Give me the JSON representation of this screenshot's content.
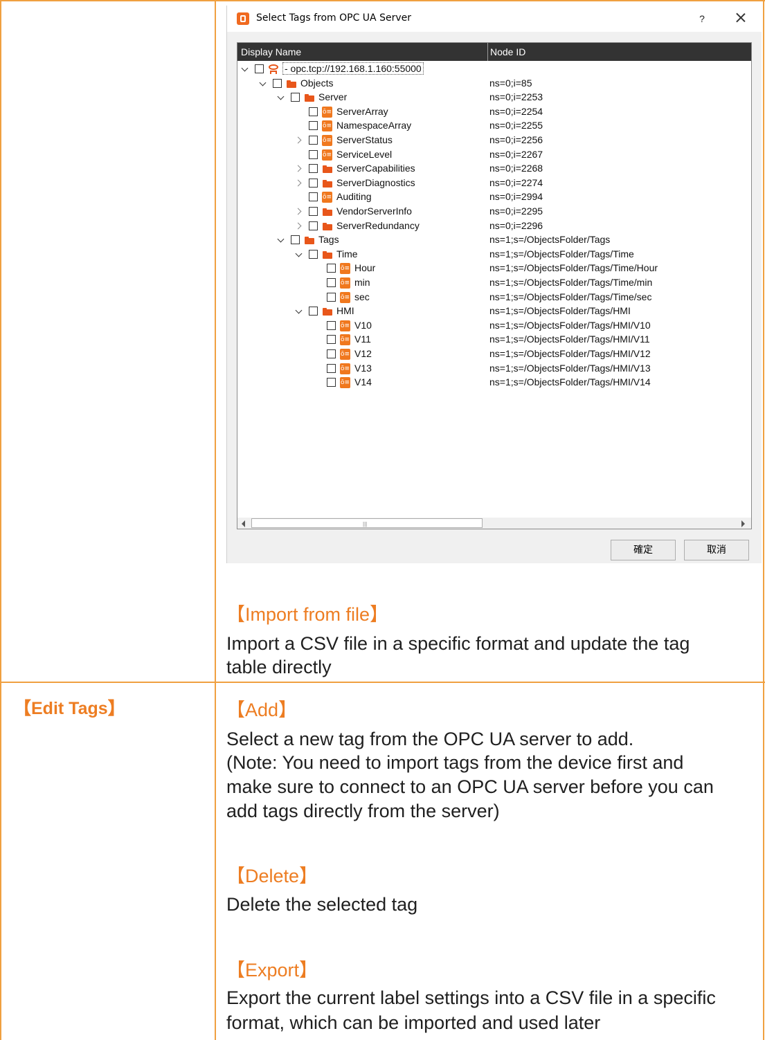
{
  "dialog": {
    "title": "Select Tags from OPC UA Server",
    "help_label": "?",
    "columns": {
      "display_name": "Display Name",
      "node_id": "Node ID"
    },
    "tree": [
      {
        "level": 0,
        "expander": "down",
        "icon": "server",
        "label": "- opc.tcp://192.168.1.160:55000",
        "node_id": ""
      },
      {
        "level": 1,
        "expander": "down",
        "icon": "folder",
        "label": "Objects",
        "node_id": "ns=0;i=85"
      },
      {
        "level": 2,
        "expander": "down",
        "icon": "folder",
        "label": "Server",
        "node_id": "ns=0;i=2253"
      },
      {
        "level": 3,
        "expander": "none",
        "icon": "var",
        "label": "ServerArray",
        "node_id": "ns=0;i=2254"
      },
      {
        "level": 3,
        "expander": "none",
        "icon": "var",
        "label": "NamespaceArray",
        "node_id": "ns=0;i=2255"
      },
      {
        "level": 3,
        "expander": "right",
        "icon": "var",
        "label": "ServerStatus",
        "node_id": "ns=0;i=2256"
      },
      {
        "level": 3,
        "expander": "none",
        "icon": "var",
        "label": "ServiceLevel",
        "node_id": "ns=0;i=2267"
      },
      {
        "level": 3,
        "expander": "right",
        "icon": "folder",
        "label": "ServerCapabilities",
        "node_id": "ns=0;i=2268"
      },
      {
        "level": 3,
        "expander": "right",
        "icon": "folder",
        "label": "ServerDiagnostics",
        "node_id": "ns=0;i=2274"
      },
      {
        "level": 3,
        "expander": "none",
        "icon": "var",
        "label": "Auditing",
        "node_id": "ns=0;i=2994"
      },
      {
        "level": 3,
        "expander": "right",
        "icon": "folder",
        "label": "VendorServerInfo",
        "node_id": "ns=0;i=2295"
      },
      {
        "level": 3,
        "expander": "right",
        "icon": "folder",
        "label": "ServerRedundancy",
        "node_id": "ns=0;i=2296"
      },
      {
        "level": 2,
        "expander": "down",
        "icon": "folder",
        "label": "Tags",
        "node_id": "ns=1;s=/ObjectsFolder/Tags"
      },
      {
        "level": 3,
        "expander": "down",
        "icon": "folder",
        "label": "Time",
        "node_id": "ns=1;s=/ObjectsFolder/Tags/Time"
      },
      {
        "level": 4,
        "expander": "none",
        "icon": "var",
        "label": "Hour",
        "node_id": "ns=1;s=/ObjectsFolder/Tags/Time/Hour"
      },
      {
        "level": 4,
        "expander": "none",
        "icon": "var",
        "label": "min",
        "node_id": "ns=1;s=/ObjectsFolder/Tags/Time/min"
      },
      {
        "level": 4,
        "expander": "none",
        "icon": "var",
        "label": "sec",
        "node_id": "ns=1;s=/ObjectsFolder/Tags/Time/sec"
      },
      {
        "level": 3,
        "expander": "down",
        "icon": "folder",
        "label": "HMI",
        "node_id": "ns=1;s=/ObjectsFolder/Tags/HMI"
      },
      {
        "level": 4,
        "expander": "none",
        "icon": "var",
        "label": "V10",
        "node_id": "ns=1;s=/ObjectsFolder/Tags/HMI/V10"
      },
      {
        "level": 4,
        "expander": "none",
        "icon": "var",
        "label": "V11",
        "node_id": "ns=1;s=/ObjectsFolder/Tags/HMI/V11"
      },
      {
        "level": 4,
        "expander": "none",
        "icon": "var",
        "label": "V12",
        "node_id": "ns=1;s=/ObjectsFolder/Tags/HMI/V12"
      },
      {
        "level": 4,
        "expander": "none",
        "icon": "var",
        "label": "V13",
        "node_id": "ns=1;s=/ObjectsFolder/Tags/HMI/V13"
      },
      {
        "level": 4,
        "expander": "none",
        "icon": "var",
        "label": "V14",
        "node_id": "ns=1;s=/ObjectsFolder/Tags/HMI/V14"
      }
    ],
    "scroll_grip": "|||",
    "ok_label": "確定",
    "cancel_label": "取消"
  },
  "doc": {
    "import_heading": "【Import from file】",
    "import_desc_1": "Import a CSV file in a specific format and update the tag",
    "import_desc_2": "table directly",
    "edit_tags_heading": "【Edit Tags】",
    "add_heading": "【Add】",
    "add_desc_1": "Select a new tag from the OPC UA server to add.",
    "add_desc_2": "(Note: You need to import tags from the device first and",
    "add_desc_3": "make sure to connect to an OPC UA server before you can",
    "add_desc_4": "add tags directly from the server)",
    "delete_heading": "【Delete】",
    "delete_desc": "Delete the selected tag",
    "export_heading": "【Export】",
    "export_desc_1": "Export the current label settings into a CSV file in a specific",
    "export_desc_2": "format, which can be imported and used later"
  },
  "colors": {
    "accent": "#ed7d22",
    "border": "#f0a040",
    "header_dark": "#333333",
    "icon_orange": "#e8561a"
  },
  "icons": {
    "app": "opc-app-icon",
    "server": "server-node-icon",
    "folder": "folder-icon",
    "variable": "variable-tag-icon"
  }
}
